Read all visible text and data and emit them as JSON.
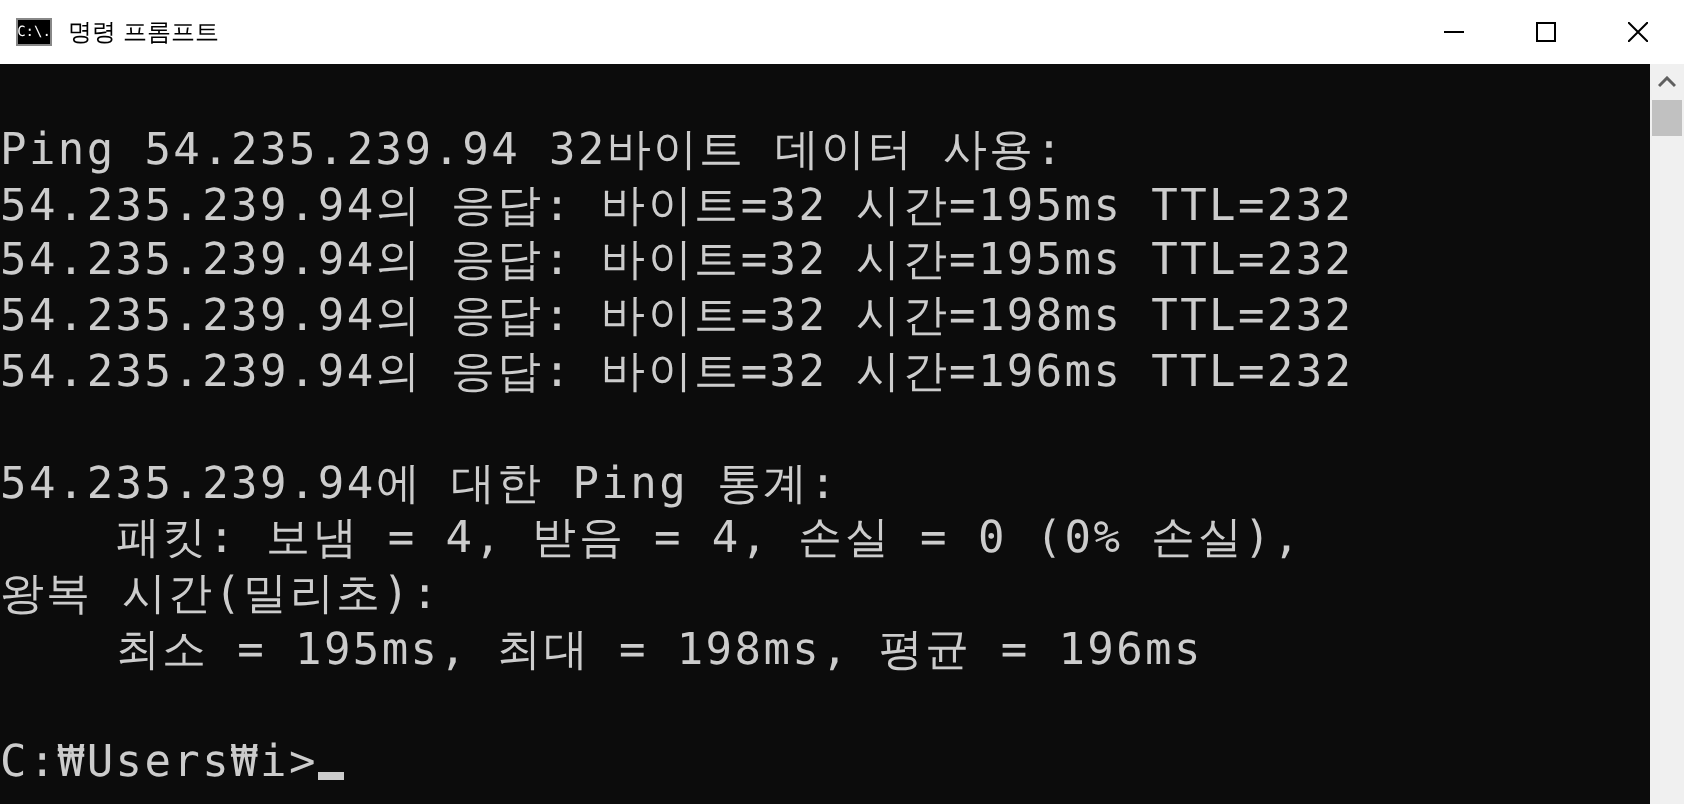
{
  "window": {
    "title": "명령 프롬프트",
    "icon_text": "C:\\."
  },
  "console": {
    "lines": [
      {
        "kind": "gap"
      },
      {
        "kind": "text",
        "text": "Ping 54.235.239.94 32바이트 데이터 사용:"
      },
      {
        "kind": "text",
        "text": "54.235.239.94의 응답: 바이트=32 시간=195ms TTL=232"
      },
      {
        "kind": "text",
        "text": "54.235.239.94의 응답: 바이트=32 시간=195ms TTL=232"
      },
      {
        "kind": "text",
        "text": "54.235.239.94의 응답: 바이트=32 시간=198ms TTL=232"
      },
      {
        "kind": "text",
        "text": "54.235.239.94의 응답: 바이트=32 시간=196ms TTL=232"
      },
      {
        "kind": "gap"
      },
      {
        "kind": "text",
        "text": "54.235.239.94에 대한 Ping 통계:"
      },
      {
        "kind": "text",
        "text": "    패킷: 보냄 = 4, 받음 = 4, 손실 = 0 (0% 손실),"
      },
      {
        "kind": "text",
        "text": "왕복 시간(밀리초):"
      },
      {
        "kind": "text",
        "text": "    최소 = 195ms, 최대 = 198ms, 평균 = 196ms"
      },
      {
        "kind": "gap"
      },
      {
        "kind": "prompt",
        "text": "C:₩Users₩i>"
      }
    ]
  }
}
